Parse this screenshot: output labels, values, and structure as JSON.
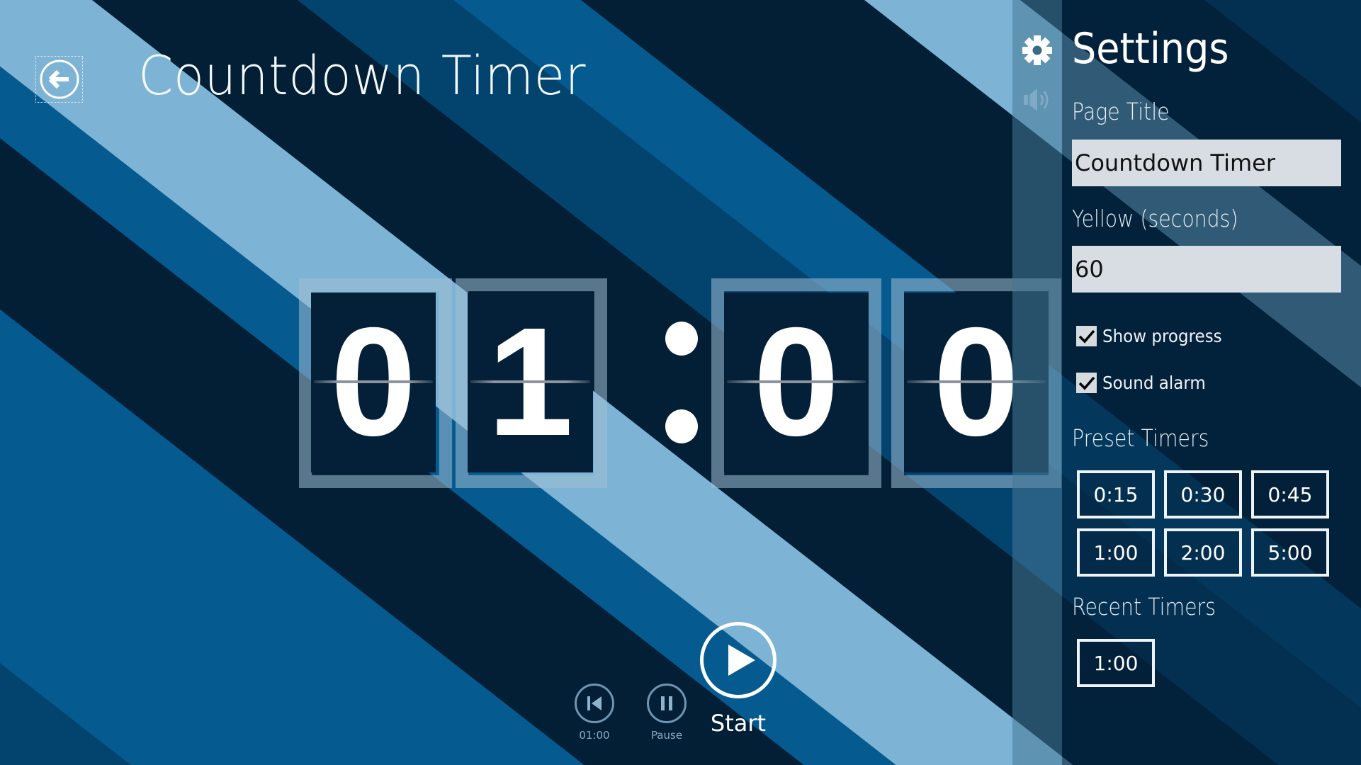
{
  "header": {
    "title": "Countdown Timer",
    "back_icon": "back-arrow-circle-icon"
  },
  "timer": {
    "digits": [
      "0",
      "1",
      "0",
      "0"
    ],
    "separator": ":",
    "display": "01:00"
  },
  "controls": {
    "reset": {
      "icon": "skip-back-icon",
      "label": "01:00"
    },
    "pause": {
      "icon": "pause-icon",
      "label": "Pause"
    },
    "start": {
      "icon": "play-icon",
      "label": "Start"
    }
  },
  "settings": {
    "strip_icons": [
      "gear-icon",
      "speaker-icon"
    ],
    "title": "Settings",
    "page_title_label": "Page Title",
    "page_title_value": "Countdown Timer",
    "yellow_label": "Yellow (seconds)",
    "yellow_value": "60",
    "checkboxes": [
      {
        "label": "Show progress",
        "checked": true
      },
      {
        "label": "Sound alarm",
        "checked": true
      }
    ],
    "preset_label": "Preset Timers",
    "presets": [
      "0:15",
      "0:30",
      "0:45",
      "1:00",
      "2:00",
      "5:00"
    ],
    "recent_label": "Recent Timers",
    "recent": [
      "1:00"
    ]
  },
  "colors": {
    "stripe_dark": "#021f36",
    "stripe_mid": "#03446f",
    "stripe_blue": "#055a8f",
    "stripe_light": "#7db3d4",
    "card_bg": "#032038",
    "input_bg": "#d7dde2"
  }
}
